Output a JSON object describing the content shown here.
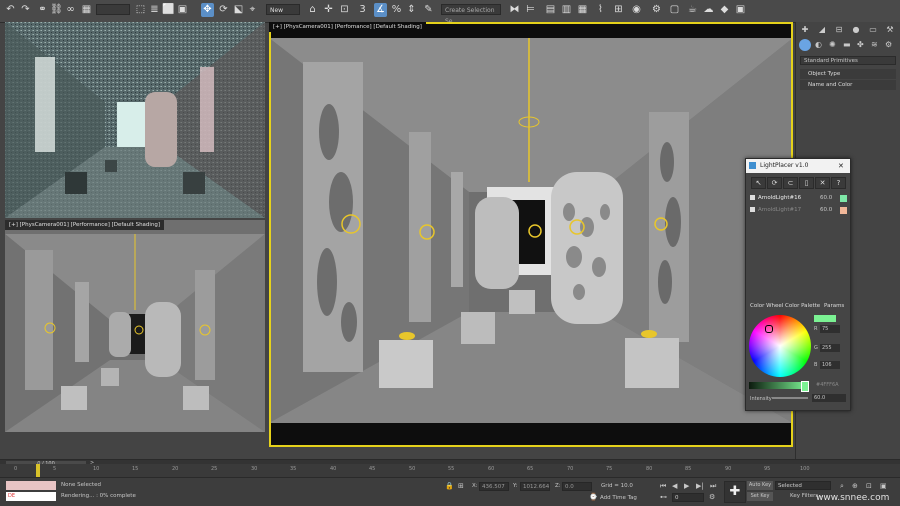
{
  "toolbar": {
    "workspace_value": "New",
    "selection_set_placeholder": "Create Selection Se",
    "icons": [
      "undo-icon",
      "redo-icon",
      "link-icon",
      "unlink-icon",
      "bind-icon",
      "select-icon",
      "select-by-name-icon",
      "region-select-icon",
      "window-crossing-icon",
      "move-icon",
      "rotate-icon",
      "scale-icon",
      "snap-icon",
      "angle-snap-icon",
      "percent-snap-icon",
      "spinner-snap-icon",
      "mirror-icon",
      "align-icon",
      "layer-icon",
      "scene-explorer-icon",
      "curve-editor-icon",
      "schematic-icon",
      "material-editor-icon",
      "render-setup-icon",
      "render-frame-icon",
      "render-icon"
    ]
  },
  "viewports": {
    "top_left_label": "",
    "bottom_left_label": "[+] [PhysCamera001] [Performance] [Default Shading]",
    "main_label": "[+] [PhysCamera001] [Perfomance] [Default Shading]"
  },
  "command_panel": {
    "dropdown": "Standard Primitives",
    "rollouts": [
      "Object Type",
      "Name and Color"
    ]
  },
  "light_placer": {
    "title": "LightPlacer v1.0",
    "close_glyph": "✕",
    "lights": [
      {
        "name": "ArnoldLight#16",
        "value": "60.0",
        "color": "#7fe8a8",
        "checked": true
      },
      {
        "name": "ArnoldLight#17",
        "value": "60.0",
        "color": "#f2b899",
        "checked": true
      }
    ],
    "tabs": [
      "Color Wheel",
      "Color Palette",
      "Params"
    ],
    "rgb": {
      "r_label": "R",
      "r": "75",
      "g_label": "G",
      "g": "255",
      "b_label": "B",
      "b": "106"
    },
    "hex": "#4FFF6A",
    "intensity_label": "Intensity",
    "intensity_value": "60.0",
    "accent": "#7bf293"
  },
  "timeline": {
    "frame_counter": "0 / 100",
    "ticks": [
      "0",
      "5",
      "10",
      "15",
      "20",
      "25",
      "30",
      "35",
      "40",
      "45",
      "50",
      "55",
      "60",
      "65",
      "70",
      "75",
      "80",
      "85",
      "90",
      "95",
      "100"
    ]
  },
  "status": {
    "selection": "None Selected",
    "progress": "Rendering... : 0% complete",
    "x_label": "X:",
    "x_value": "436.507",
    "y_label": "Y:",
    "y_value": "1012.664",
    "z_label": "Z:",
    "z_value": "0.0",
    "grid": "Grid = 10.0",
    "add_time_tag": "Add Time Tag",
    "auto_key": "Auto Key",
    "set_key": "Set Key",
    "selected": "Selected",
    "key_filters": "Key Filters...",
    "frame_value": "0",
    "listener_value": "DE",
    "watermark": "www.snnee.com"
  }
}
